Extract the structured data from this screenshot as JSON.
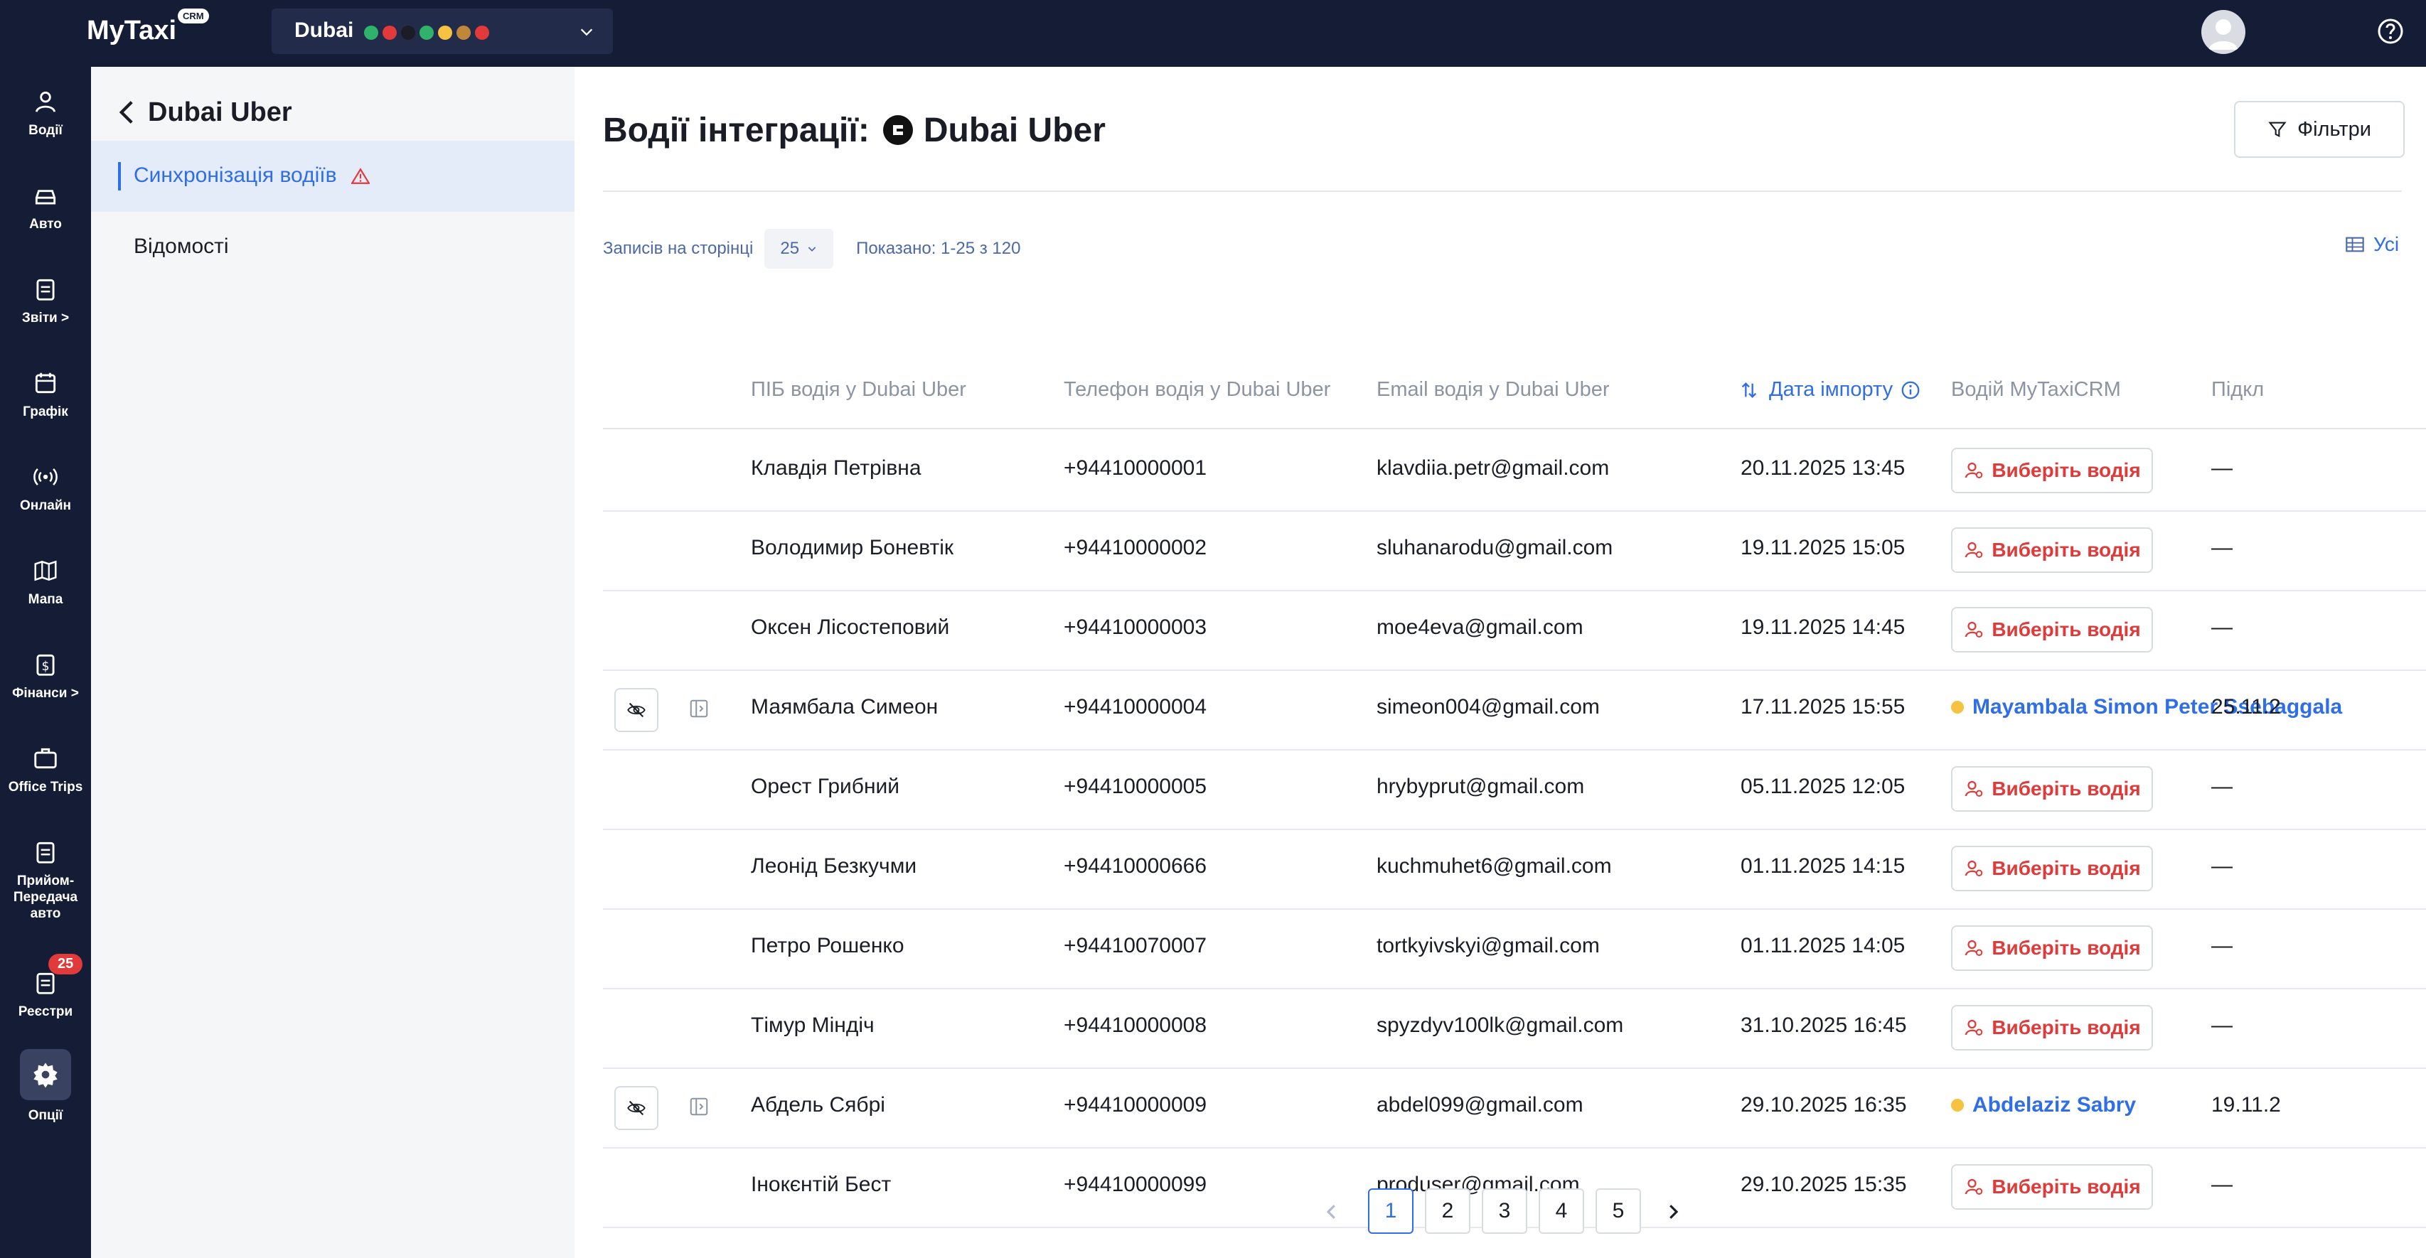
{
  "topbar": {
    "logo": "MyTaxi",
    "logo_badge": "CRM",
    "city": "Dubai",
    "status_colors": [
      "#2fb36a",
      "#e03a3a",
      "#1a1d26",
      "#2fb36a",
      "#f5c242",
      "#c0873a",
      "#e03a3a"
    ]
  },
  "leftnav": {
    "items": [
      {
        "label": "Водії",
        "icon": "user-icon"
      },
      {
        "label": "Авто",
        "icon": "car-icon"
      },
      {
        "label": "Звіти >",
        "icon": "clipboard-icon"
      },
      {
        "label": "Графік",
        "icon": "calendar-icon"
      },
      {
        "label": "Онлайн",
        "icon": "broadcast-icon"
      },
      {
        "label": "Мапа",
        "icon": "map-icon"
      },
      {
        "label": "Фінанси >",
        "icon": "finance-icon"
      },
      {
        "label": "Office Trips",
        "icon": "briefcase-icon"
      },
      {
        "label": "Прийом-Передача авто",
        "icon": "clipboard-icon"
      },
      {
        "label": "Реєстри",
        "icon": "clipboard-icon",
        "badge": "25"
      },
      {
        "label": "Опції",
        "icon": "gear-icon"
      }
    ]
  },
  "subnav": {
    "title": "Dubai Uber",
    "items": [
      {
        "label": "Синхронізація водіїв",
        "active": true
      },
      {
        "label": "Відомості",
        "active": false
      }
    ]
  },
  "main": {
    "title_prefix": "Водії інтеграції:",
    "title_integration": "Dubai Uber",
    "filter_label": "Фільтри",
    "records_label": "Записів на сторінці",
    "per_page": "25",
    "shown_label": "Показано: 1-25 з 120",
    "columns_label": "Усі"
  },
  "table": {
    "headers": {
      "name": "ПІБ водія у Dubai Uber",
      "phone": "Телефон водія у Dubai Uber",
      "email": "Email водія у Dubai Uber",
      "date": "Дата імпорту",
      "driver": "Водій MyTaxiCRM",
      "extra": "Підкл"
    },
    "choose_label": "Виберіть водія",
    "rows": [
      {
        "name": "Клавдія Петрівна",
        "phone": "+94410000001",
        "email": "klavdiia.petr@gmail.com",
        "date": "20.11.2025 13:45",
        "linked": "",
        "extra": "—"
      },
      {
        "name": "Володимир Боневтік",
        "phone": "+94410000002",
        "email": "sluhanarodu@gmail.com",
        "date": "19.11.2025 15:05",
        "linked": "",
        "extra": "—"
      },
      {
        "name": "Оксен Лісостеповий",
        "phone": "+94410000003",
        "email": "moe4eva@gmail.com",
        "date": "19.11.2025 14:45",
        "linked": "",
        "extra": "—"
      },
      {
        "name": "Маямбала Симеон",
        "phone": "+94410000004",
        "email": "simeon004@gmail.com",
        "date": "17.11.2025 15:55",
        "linked": "Mayambala Simon Peter Ssebaggala",
        "extra": "25.11.2"
      },
      {
        "name": "Орест Грибний",
        "phone": "+94410000005",
        "email": "hrybyprut@gmail.com",
        "date": "05.11.2025 12:05",
        "linked": "",
        "extra": "—"
      },
      {
        "name": "Леонід Безкучми",
        "phone": "+94410000666",
        "email": "kuchmuhet6@gmail.com",
        "date": "01.11.2025 14:15",
        "linked": "",
        "extra": "—"
      },
      {
        "name": "Петро Рошенко",
        "phone": "+94410070007",
        "email": "tortkyivskyi@gmail.com",
        "date": "01.11.2025 14:05",
        "linked": "",
        "extra": "—"
      },
      {
        "name": "Тімур Міндіч",
        "phone": "+94410000008",
        "email": "spyzdyv100lk@gmail.com",
        "date": "31.10.2025 16:45",
        "linked": "",
        "extra": "—"
      },
      {
        "name": "Абдель Сябрі",
        "phone": "+94410000009",
        "email": "abdel099@gmail.com",
        "date": "29.10.2025 16:35",
        "linked": "Abdelaziz Sabry",
        "extra": "19.11.2"
      },
      {
        "name": "Інокєнтій Бест",
        "phone": "+94410000099",
        "email": "produser@gmail.com",
        "date": "29.10.2025 15:35",
        "linked": "",
        "extra": "—"
      }
    ]
  },
  "pagination": {
    "pages": [
      "1",
      "2",
      "3",
      "4",
      "5"
    ],
    "current": "1"
  }
}
